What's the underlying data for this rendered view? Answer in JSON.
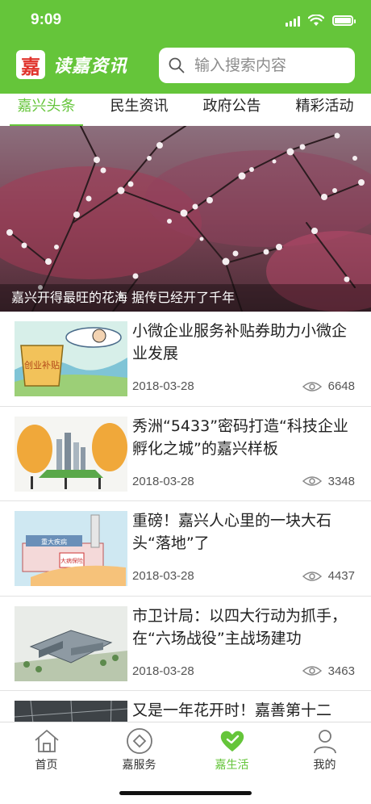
{
  "status": {
    "time": "9:09"
  },
  "header": {
    "logo_char": "嘉",
    "app_name": "读嘉资讯",
    "search_placeholder": "输入搜索内容"
  },
  "tabs": [
    {
      "label": "嘉兴头条",
      "active": true
    },
    {
      "label": "民生资讯",
      "active": false
    },
    {
      "label": "政府公告",
      "active": false
    },
    {
      "label": "精彩活动",
      "active": false
    }
  ],
  "banner": {
    "caption": "嘉兴开得最旺的花海 据传已经开了千年"
  },
  "news": [
    {
      "title": "小微企业服务补贴券助力小微企业发展",
      "date": "2018-03-28",
      "views": "6648",
      "thumb_text": "创业补贴"
    },
    {
      "title": "秀洲“5433”密码打造“科技企业孵化之城”的嘉兴样板",
      "date": "2018-03-28",
      "views": "3348"
    },
    {
      "title": "重磅！嘉兴人心里的一块大石头“落地”了",
      "date": "2018-03-28",
      "views": "4437",
      "thumb_text": "重大疾病",
      "thumb_text2": "大病保险"
    },
    {
      "title": "市卫计局：以四大行动为抓手，在“六场战役”主战场建功",
      "date": "2018-03-28",
      "views": "3463"
    },
    {
      "title": "又是一年花开时！嘉善第十二",
      "date": "",
      "views": ""
    }
  ],
  "tabbar": [
    {
      "label": "首页",
      "icon": "home-icon",
      "active": false
    },
    {
      "label": "嘉服务",
      "icon": "service-icon",
      "active": false
    },
    {
      "label": "嘉生活",
      "icon": "heart-icon",
      "active": true
    },
    {
      "label": "我的",
      "icon": "user-icon",
      "active": false
    }
  ],
  "colors": {
    "brand": "#65c53a",
    "text": "#222222",
    "muted": "#555555"
  }
}
